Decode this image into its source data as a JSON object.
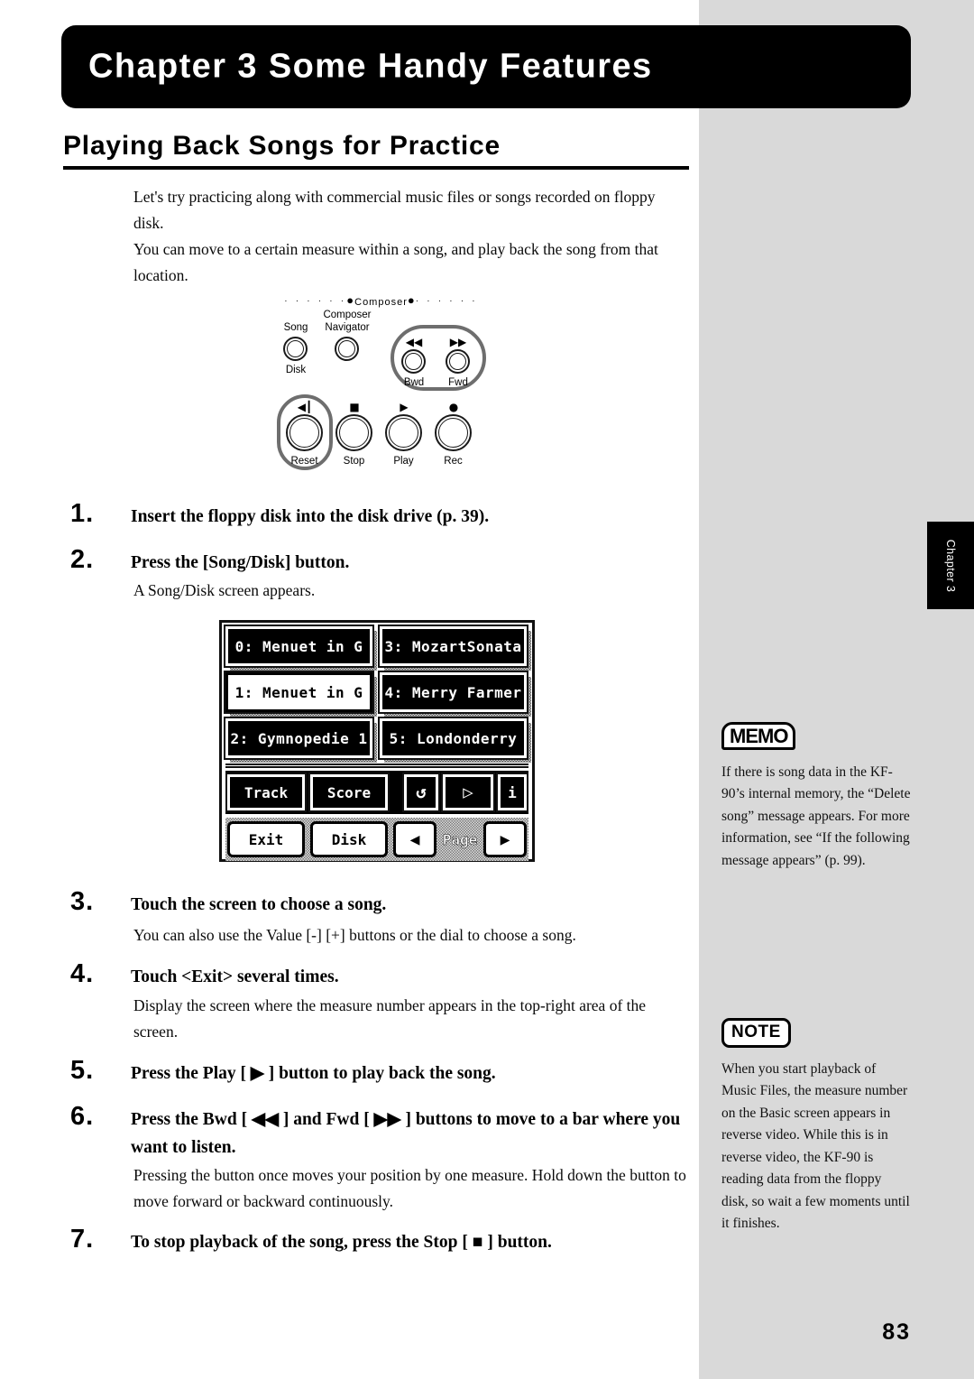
{
  "banner": {
    "title": "Chapter 3 Some Handy Features"
  },
  "section": {
    "heading": "Playing Back Songs for Practice"
  },
  "intro": {
    "p1": "Let's try practicing along with commercial music files or songs recorded on floppy disk.",
    "p2": "You can move to a certain measure within a song, and play back the song from that location."
  },
  "panel": {
    "group_label": "Composer",
    "dots_left": "· · · · · ·",
    "dots_right": "· · · · · ·",
    "dot_big": "●",
    "buttons": [
      {
        "top": "Song",
        "bottom": "Disk",
        "glyph": ""
      },
      {
        "top": "Composer Navigator",
        "bottom": "",
        "glyph": ""
      },
      {
        "top": "",
        "bottom": "Bwd",
        "glyph": "◀◀"
      },
      {
        "top": "",
        "bottom": "Fwd",
        "glyph": "▶▶"
      },
      {
        "top": "",
        "bottom": "Reset",
        "glyph": "⏮"
      },
      {
        "top": "",
        "bottom": "Stop",
        "glyph": "■"
      },
      {
        "top": "",
        "bottom": "Play",
        "glyph": "▶"
      },
      {
        "top": "",
        "bottom": "Rec",
        "glyph": "●"
      }
    ],
    "composer_line1": "Composer",
    "composer_line2": "Navigator",
    "label_song": "Song",
    "label_disk": "Disk",
    "label_bwd": "Bwd",
    "label_fwd": "Fwd",
    "label_reset": "Reset",
    "label_stop": "Stop",
    "label_play": "Play",
    "label_rec": "Rec",
    "glyph_bwd": "◀◀",
    "glyph_fwd": "▶▶",
    "glyph_reset": "◀┃",
    "glyph_stop": "■",
    "glyph_play": "▶",
    "glyph_rec": "●"
  },
  "steps": [
    {
      "num": "1.",
      "head": "Insert the floppy disk into the disk drive (p. 39).",
      "body": ""
    },
    {
      "num": "2.",
      "head": "Press the [Song/Disk] button.",
      "body": "A Song/Disk screen appears."
    },
    {
      "num": "3.",
      "head": "Touch the screen to choose a song.",
      "body": "You can also use the Value [-] [+] buttons or the dial to choose a song."
    },
    {
      "num": "4.",
      "head": "Touch <Exit> several times.",
      "body": "Display the screen where the measure number appears in the top-right area of the screen."
    },
    {
      "num": "5.",
      "head": "Press the Play [ ▶ ] button to play back the song.",
      "body": ""
    },
    {
      "num": "6.",
      "head": "Press the Bwd [ ◀◀ ] and Fwd [ ▶▶ ] buttons to move to a bar where you want to listen.",
      "body": "Pressing the button once moves your position by one measure. Hold down the button to move forward or backward continuously."
    },
    {
      "num": "7.",
      "head": "To stop playback of the song, press the Stop [ ■ ] button.",
      "body": ""
    }
  ],
  "lcd": {
    "songs": [
      {
        "label": "0: Menuet in G",
        "selected": false
      },
      {
        "label": "3: MozartSonata",
        "selected": false
      },
      {
        "label": "1: Menuet in G",
        "selected": true
      },
      {
        "label": "4: Merry Farmer",
        "selected": false
      },
      {
        "label": "2: Gymnopedie 1",
        "selected": false
      },
      {
        "label": "5: Londonderry",
        "selected": false
      }
    ],
    "mid_row": {
      "track": "Track",
      "score": "Score",
      "loop_icon": "↺",
      "play_icon": "▷",
      "info_icon": "i"
    },
    "bottom_row": {
      "exit": "Exit",
      "disk": "Disk",
      "prev_icon": "◀",
      "page": "Page",
      "next_icon": "▶"
    }
  },
  "sidebar": {
    "memo_badge": "MEMO",
    "memo_text": "If there is song data in the KF-90’s internal memory, the “Delete song” message appears. For more information, see “If the following message appears” (p. 99).",
    "note_badge": "NOTE",
    "note_text": "When you start playback of Music Files, the measure number on the Basic screen appears in reverse video. While this is in reverse video, the KF-90 is reading data from the floppy disk, so wait a few moments until it finishes."
  },
  "chapter_tab": {
    "label": "Chapter 3"
  },
  "folio": {
    "page_number": "83"
  }
}
